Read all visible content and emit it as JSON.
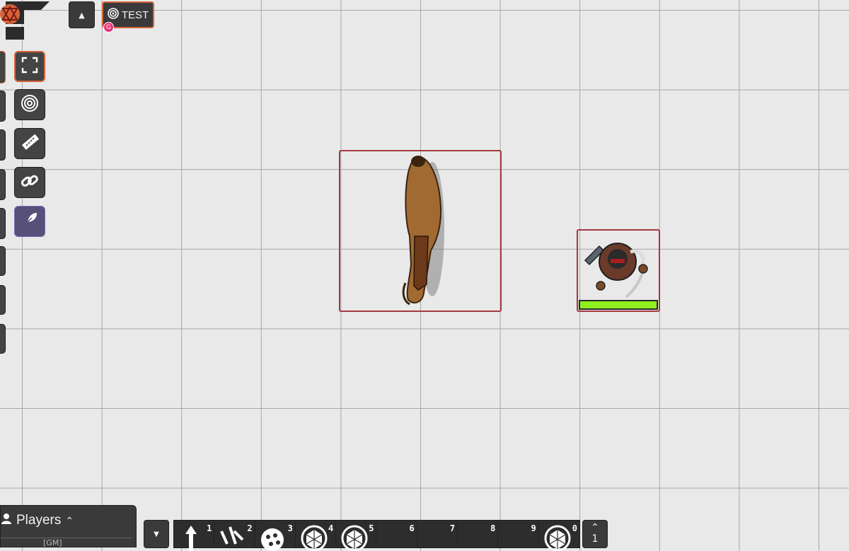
{
  "scene": {
    "name": "TEST",
    "gm_badge": "G"
  },
  "left_controls": [
    {
      "name": "fullscreen-icon",
      "active": true
    },
    {
      "name": "target-icon",
      "active": false
    },
    {
      "name": "ruler-icon",
      "active": false
    },
    {
      "name": "link-icon",
      "active": false
    },
    {
      "name": "feather-icon",
      "active": false,
      "highlight": true
    }
  ],
  "tokens": [
    {
      "name": "horse-token",
      "shape": "horse"
    },
    {
      "name": "warrior-token",
      "shape": "warrior",
      "hp_fraction": 1.0
    }
  ],
  "players": {
    "title": "Players",
    "row_text": "[GM]"
  },
  "hotbar": {
    "slots": [
      {
        "number": "1",
        "icon": "arrow-up-icon"
      },
      {
        "number": "2",
        "icon": "scales-icon"
      },
      {
        "number": "3",
        "icon": "film-reel-icon"
      },
      {
        "number": "4",
        "icon": "d20-target-icon"
      },
      {
        "number": "5",
        "icon": "d20-target-icon"
      },
      {
        "number": "6",
        "icon": ""
      },
      {
        "number": "7",
        "icon": ""
      },
      {
        "number": "8",
        "icon": ""
      },
      {
        "number": "9",
        "icon": ""
      },
      {
        "number": "0",
        "icon": "d20-target-icon"
      }
    ],
    "page": "1"
  },
  "colors": {
    "token_border": "#a33a3f",
    "accent": "#d5643a",
    "hp_green": "#8ff01e",
    "gm_pink": "#e8327a"
  }
}
